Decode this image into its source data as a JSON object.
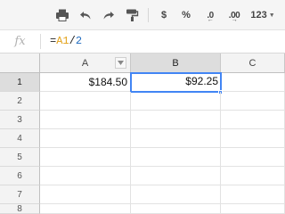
{
  "toolbar": {
    "print_icon": "printer-icon",
    "undo_icon": "undo-icon",
    "redo_icon": "redo-icon",
    "paint_format_icon": "paint-format-icon",
    "currency_label": "$",
    "percent_label": "%",
    "decrease_decimal_label": ".0",
    "increase_decimal_label": ".00",
    "more_formats_label": "123"
  },
  "formula_bar": {
    "fx_label": "fx",
    "formula_prefix": "=",
    "formula_ref": "A1",
    "formula_op": "/",
    "formula_num": "2"
  },
  "grid": {
    "columns": [
      "A",
      "B",
      "C"
    ],
    "rows": [
      "1",
      "2",
      "3",
      "4",
      "5",
      "6",
      "7",
      "8"
    ],
    "cells": {
      "A1": "$184.50",
      "B1": "$92.25"
    },
    "active_cell": "B1"
  },
  "colors": {
    "selection": "#4285f4",
    "header_bg": "#f3f3f3",
    "selected_header_bg": "#dddddd",
    "reference": "#e3a21a",
    "number": "#1f6bbf"
  }
}
